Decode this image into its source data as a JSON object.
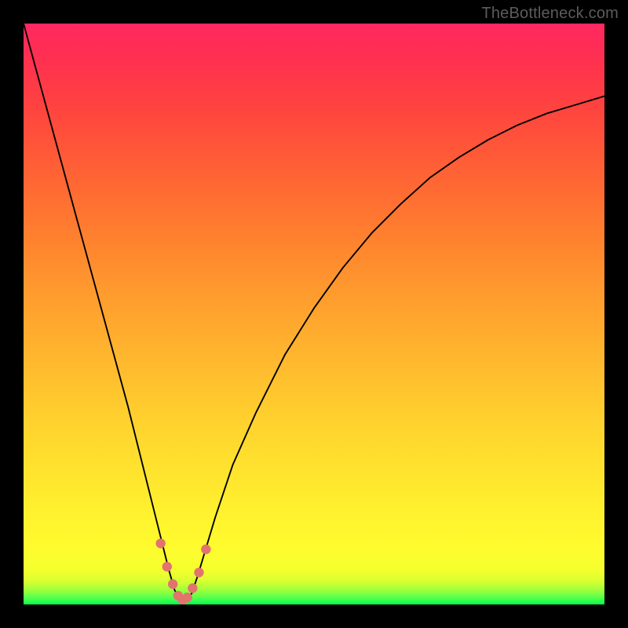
{
  "attribution": "TheBottleneck.com",
  "colors": {
    "page_bg": "#000000",
    "curve_stroke": "#000000",
    "marker_fill": "#e2736f",
    "gradient_top": "#ff2860",
    "gradient_mid": "#fff12e",
    "gradient_bottom": "#00ff4e"
  },
  "chart_data": {
    "type": "line",
    "title": "",
    "xlabel": "",
    "ylabel": "",
    "xlim": [
      0,
      100
    ],
    "ylim": [
      0,
      100
    ],
    "legend": false,
    "grid": false,
    "axes_visible": false,
    "notes": "Bottleneck-style curve: y=100 means max bottleneck (top, red) and y=0 means no bottleneck (bottom, green). Minimum around x≈27. Values estimated from pixel positions.",
    "series": [
      {
        "name": "bottleneck-curve",
        "x": [
          0,
          3,
          6,
          9,
          12,
          15,
          18,
          20,
          22,
          23.5,
          25,
          26,
          27,
          28,
          29,
          30,
          31.5,
          33,
          36,
          40,
          45,
          50,
          55,
          60,
          65,
          70,
          75,
          80,
          85,
          90,
          95,
          100
        ],
        "y": [
          100,
          89,
          78,
          67,
          56,
          45,
          34,
          26,
          18,
          12,
          6,
          2.5,
          0.5,
          0.5,
          2,
          5,
          10,
          15,
          24,
          33,
          43,
          51,
          58,
          64,
          69,
          73.5,
          77,
          80,
          82.5,
          84.5,
          86,
          87.5
        ]
      }
    ],
    "markers": {
      "name": "near-optimum-points",
      "x": [
        23.6,
        24.7,
        25.7,
        26.6,
        27.4,
        28.2,
        29.1,
        30.2,
        31.4
      ],
      "y": [
        10.5,
        6.5,
        3.5,
        1.5,
        0.8,
        1.2,
        2.8,
        5.5,
        9.5
      ]
    }
  }
}
